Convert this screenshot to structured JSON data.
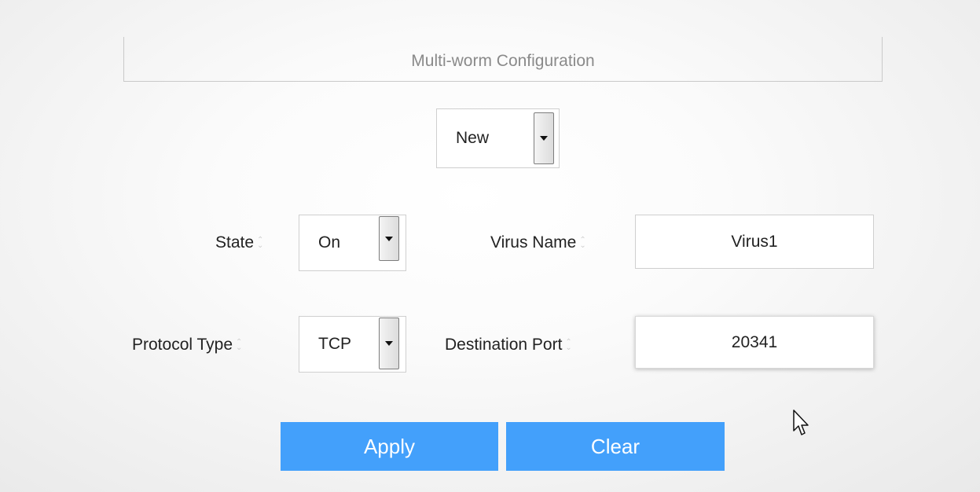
{
  "title": "Multi-worm Configuration",
  "mode_select": {
    "value": "New"
  },
  "state": {
    "label": "State",
    "value": "On"
  },
  "virus_name": {
    "label": "Virus Name",
    "value": "Virus1"
  },
  "protocol_type": {
    "label": "Protocol Type",
    "value": "TCP"
  },
  "destination_port": {
    "label": "Destination Port",
    "value": "20341"
  },
  "buttons": {
    "apply": "Apply",
    "clear": "Clear"
  },
  "colors": {
    "button_bg": "#43a0fb",
    "title_text": "#8a8a8a"
  },
  "icons": {
    "dropdown": "chevron-down-icon",
    "sort": "sort-icon",
    "cursor": "mouse-pointer-icon"
  }
}
